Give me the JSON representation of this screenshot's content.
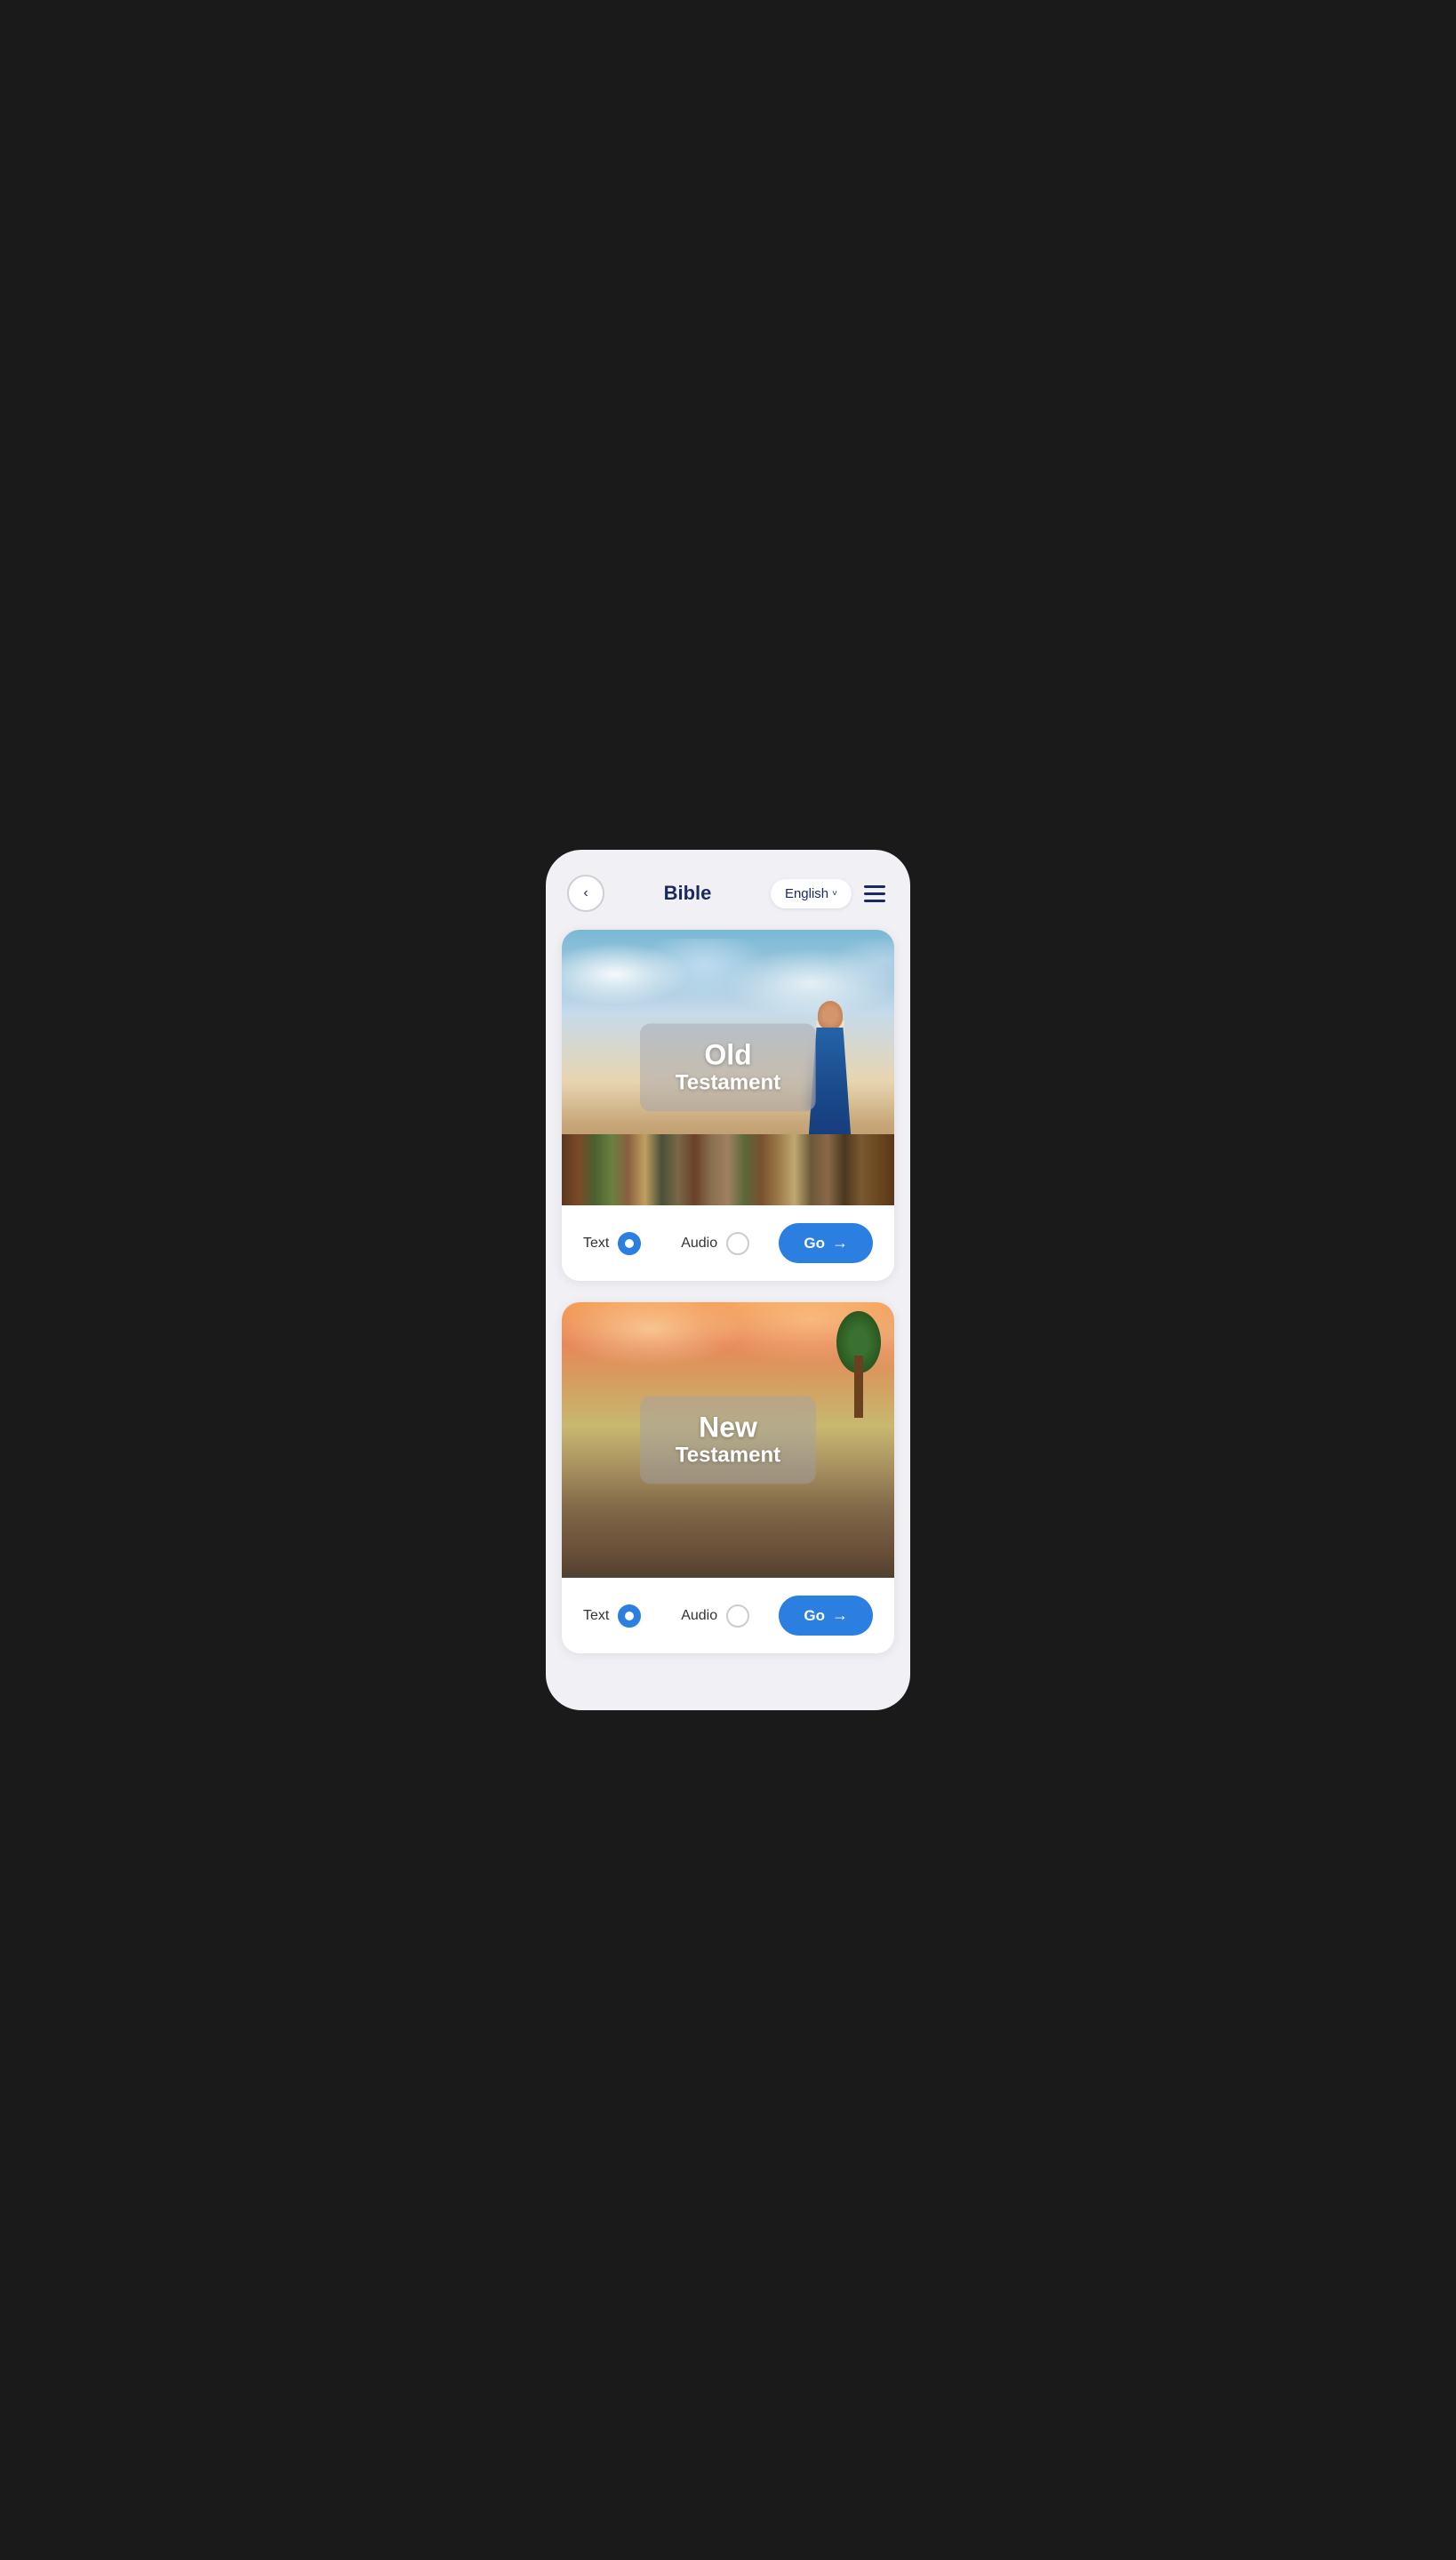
{
  "header": {
    "back_label": "‹",
    "title": "Bible",
    "language_label": "English",
    "language_chevron": "˅",
    "menu_icon": "hamburger-menu"
  },
  "cards": [
    {
      "id": "old-testament",
      "title_line1": "Old",
      "title_line2": "Testament",
      "text_label": "Text",
      "audio_label": "Audio",
      "text_selected": true,
      "audio_selected": false,
      "go_label": "Go",
      "go_arrow": "→"
    },
    {
      "id": "new-testament",
      "title_line1": "New",
      "title_line2": "Testament",
      "text_label": "Text",
      "audio_label": "Audio",
      "text_selected": true,
      "audio_selected": false,
      "go_label": "Go",
      "go_arrow": "→"
    }
  ],
  "colors": {
    "accent": "#2b7fe0",
    "title_color": "#1a2a5e"
  }
}
